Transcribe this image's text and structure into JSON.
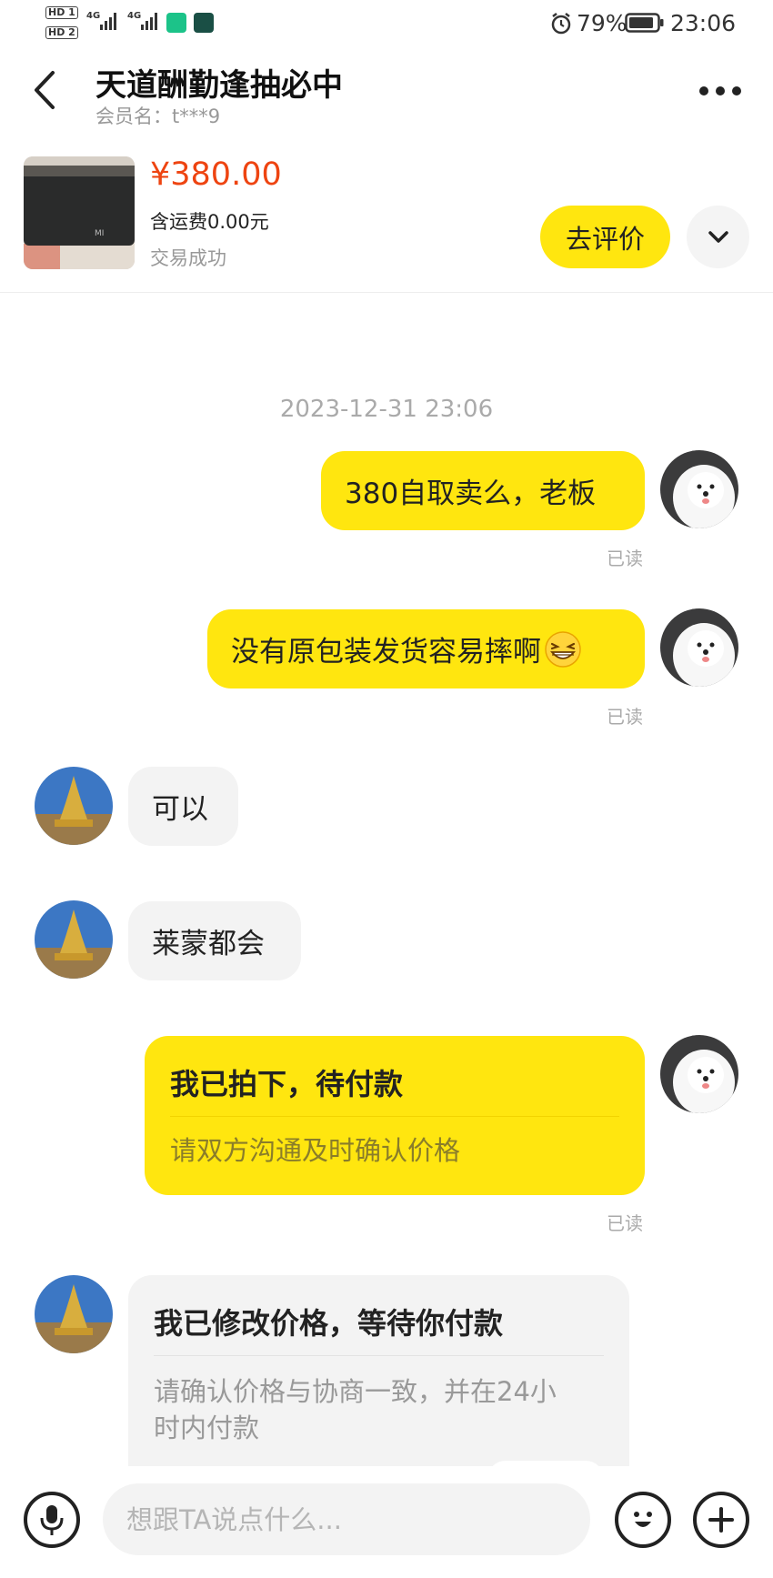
{
  "status_bar": {
    "hd1": "HD 1",
    "hd2": "HD 2",
    "net1": "4G",
    "net2": "4G",
    "battery": "79%",
    "time": "23:06"
  },
  "header": {
    "title": "天道酬勤逢抽必中",
    "member": "会员名：t***9"
  },
  "product": {
    "price": "¥380.00",
    "shipping": "含运费0.00元",
    "status": "交易成功",
    "review_label": "去评价",
    "img_brand": "MI"
  },
  "chat": {
    "timestamp": "2023-12-31 23:06",
    "messages": [
      {
        "text": "380自取卖么，老板",
        "read": "已读"
      },
      {
        "text": "没有原包装发货容易摔啊",
        "read": "已读"
      },
      {
        "text": "可以"
      },
      {
        "text": "莱蒙都会"
      }
    ],
    "card_me": {
      "title": "我已拍下，待付款",
      "desc": "请双方沟通及时确认价格",
      "read": "已读"
    },
    "card_them": {
      "title": "我已修改价格，等待你付款",
      "desc_line1": "请确认价格与协商一致，并在24小",
      "desc_line2": "时内付款"
    }
  },
  "input": {
    "placeholder": "想跟TA说点什么..."
  },
  "colors": {
    "accent_yellow": "#ffe60f",
    "price_red": "#ee4411",
    "bubble_gray": "#f3f3f3",
    "muted_text": "#999999"
  },
  "icons": [
    "back-arrow-icon",
    "more-icon",
    "chevron-down-icon",
    "voice-icon",
    "emoji-icon",
    "plus-icon",
    "grin-emoji-icon",
    "alarm-icon",
    "battery-icon"
  ]
}
